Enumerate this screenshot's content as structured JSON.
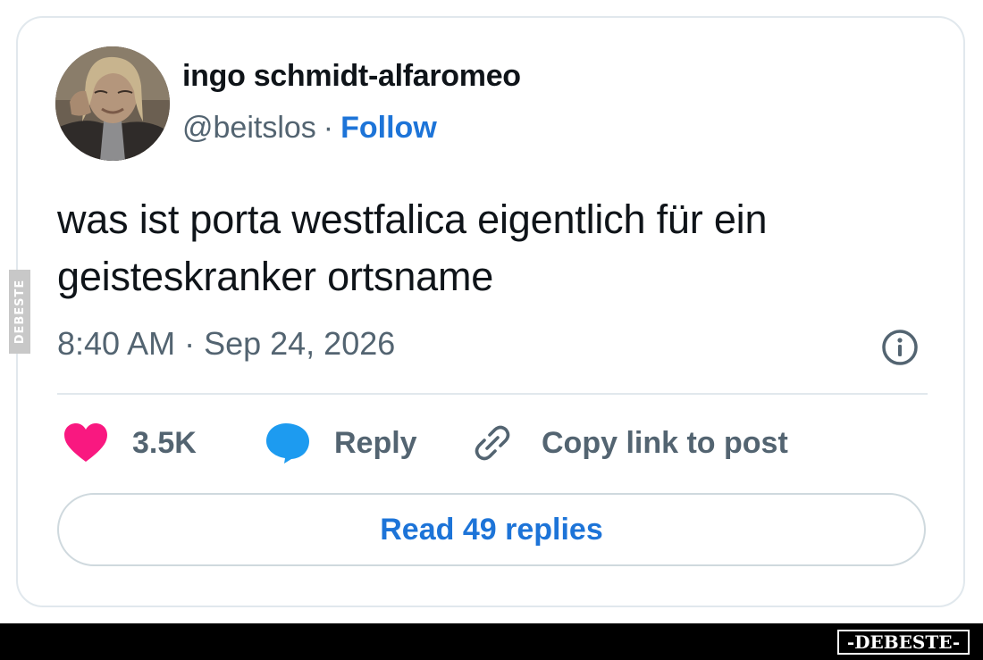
{
  "tweet": {
    "author_name": "ingo schmidt-alfaromeo",
    "handle": "@beitslos",
    "separator": "·",
    "follow_label": "Follow",
    "text_line1": "was ist porta westfalica eigentlich für ein",
    "text_line2": "geisteskranker ortsname",
    "timestamp": "8:40 AM · Sep 24, 2026"
  },
  "actions": {
    "likes_count": "3.5K",
    "reply_label": "Reply",
    "copy_link_label": "Copy link to post",
    "read_replies_label": "Read 49 replies"
  },
  "watermark": {
    "text": "-DEBESTE-",
    "side_text": "DEBESTE"
  },
  "colors": {
    "accent_blue": "#1d74d8",
    "heart_pink": "#f91880",
    "reply_bubble_blue": "#1d9bf0",
    "secondary_text": "#536471",
    "border": "#e1e8ed"
  },
  "icons": [
    "avatar-photo",
    "info-icon",
    "heart-icon",
    "reply-bubble-icon",
    "link-icon"
  ]
}
